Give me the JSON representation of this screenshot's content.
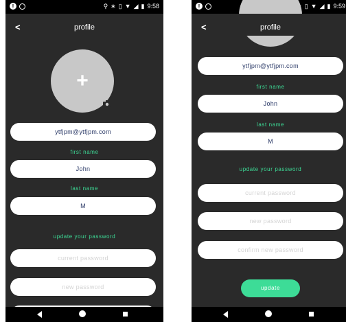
{
  "statusbar": {
    "time_left": "9:58",
    "time_right": "9:59"
  },
  "header": {
    "title": "profile",
    "back_label": "<"
  },
  "avatar": {
    "plus_label": "+"
  },
  "form": {
    "email_value": "ytfjpm@ytfjpm.com",
    "first_name_label": "first name",
    "first_name_value": "John",
    "last_name_label": "last name",
    "last_name_value": "M",
    "update_password_label": "update your password",
    "current_password_placeholder": "current password",
    "new_password_placeholder": "new password",
    "confirm_password_placeholder": "confirm new password",
    "update_button_label": "update"
  },
  "colors": {
    "accent": "#3ddc97",
    "background": "#2a2a2a",
    "field": "#ffffff",
    "text": "#2b3a67"
  }
}
